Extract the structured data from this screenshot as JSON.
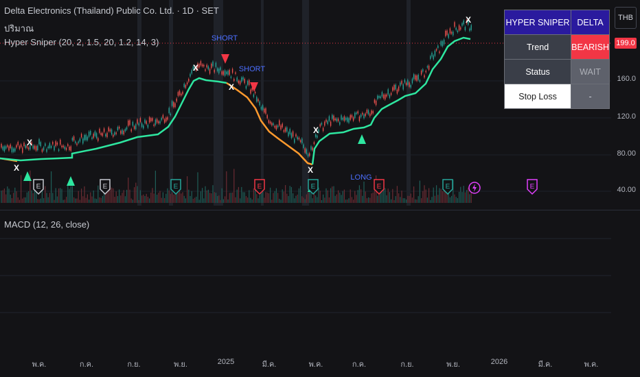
{
  "legend": {
    "symbol": "Delta Electronics (Thailand) Public Co. Ltd. · 1D · SET",
    "volume": "ปริมาณ",
    "indicator": "Hyper Sniper (20, 2, 1.5, 20, 1.2, 14, 3)",
    "macd": "MACD (12, 26, close)"
  },
  "price_scale": {
    "currency": "THB",
    "last_price": "199.0",
    "ticks": [
      "160.0",
      "120.0",
      "80.00",
      "40.00"
    ]
  },
  "time_axis": [
    "พ.ค.",
    "ก.ค.",
    "ก.ย.",
    "พ.ย.",
    "2025",
    "มี.ค.",
    "พ.ค.",
    "ก.ค.",
    "ก.ย.",
    "พ.ย.",
    "2026",
    "มี.ค.",
    "พ.ค."
  ],
  "status_table": {
    "title": "HYPER SNIPER",
    "ticker": "DELTA",
    "trend_label": "Trend",
    "trend_value": "BEARISH",
    "status_label": "Status",
    "status_value": "WAIT",
    "stop_label": "Stop Loss",
    "stop_value": "-"
  },
  "signals": {
    "short": "SHORT",
    "long": "LONG",
    "exit": "X",
    "earnings": "E"
  },
  "colors": {
    "bull_line": "#2ee6a0",
    "bear_line": "#ff9a2e",
    "buy_marker": "#2ee6a0",
    "sell_marker": "#f23645",
    "short_label": "#4c6fff",
    "long_label": "#4c6fff",
    "earnings_green": "#26a69a",
    "earnings_red": "#f23645",
    "dividend": "#e040fb"
  }
}
